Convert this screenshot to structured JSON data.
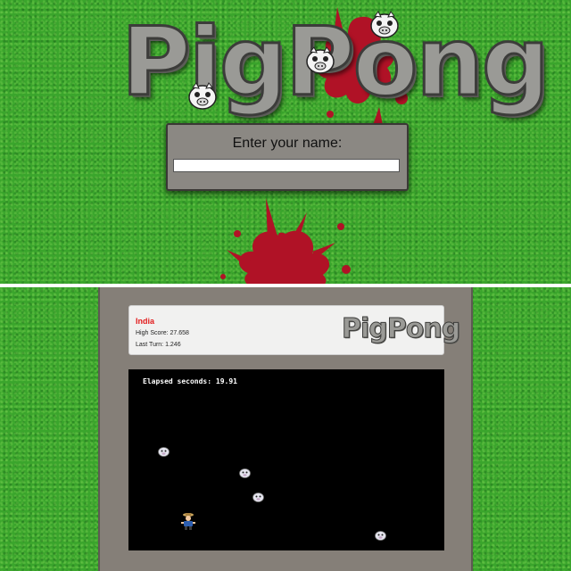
{
  "title_screen": {
    "logo_text": "PigPong",
    "name_prompt": "Enter your name:",
    "name_value": ""
  },
  "game_screen": {
    "player_name": "India",
    "high_score_text": "High Score: 27.658",
    "last_turn_text": "Last Turn: 1.246",
    "logo_text": "PigPong",
    "elapsed_text": "Elapsed seconds: 19.91"
  },
  "colors": {
    "grass": "#3aa52c",
    "blood": "#b01226",
    "dialog": "#8b8883",
    "frame": "#857f78",
    "arena": "#000000",
    "player_name": "#e21b1b"
  },
  "icons": {
    "pig": "pig-face-icon",
    "farmer": "farmer-paddle-icon",
    "splat": "blood-splat"
  }
}
